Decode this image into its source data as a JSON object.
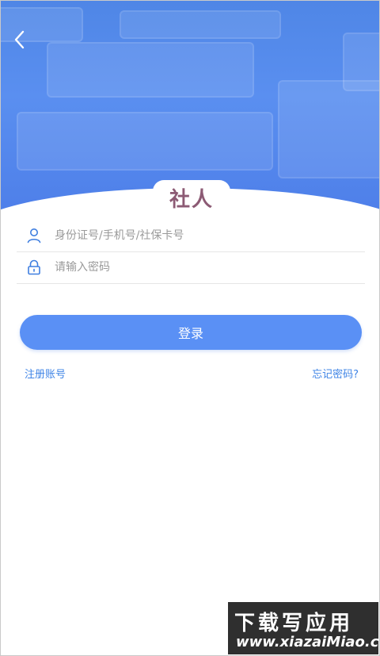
{
  "header": {
    "logo_text": "社人"
  },
  "form": {
    "id_placeholder": "身份证号/手机号/社保卡号",
    "password_placeholder": "请输入密码",
    "login_label": "登录"
  },
  "links": {
    "register": "注册账号",
    "forgot": "忘记密码?"
  },
  "watermark": {
    "title": "下载写应用",
    "url": "www.xiazaiMiao.com"
  },
  "colors": {
    "primary": "#5a90f5",
    "link": "#3f84e6",
    "header": "#4f86e6"
  }
}
